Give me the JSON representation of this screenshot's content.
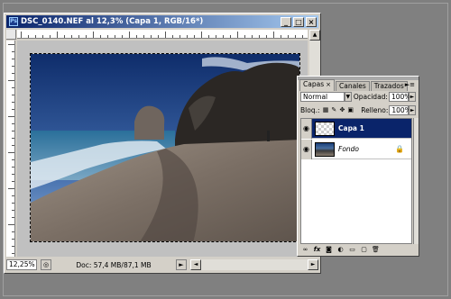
{
  "document": {
    "title": "DSC_0140.NEF al 12,3% (Capa 1, RGB/16*)",
    "app_icon": "Ps",
    "window_buttons": [
      "_",
      "□",
      "×"
    ],
    "zoom": "12,25%",
    "doc_info": "Doc: 57,4 MB/87,1 MB",
    "scroll_left": "◄",
    "scroll_right": "►",
    "scroll_up": "▲",
    "scroll_down": "▼"
  },
  "layers_panel": {
    "tabs": [
      {
        "label": "Capas",
        "active": true,
        "close": "×"
      },
      {
        "label": "Canales",
        "active": false
      },
      {
        "label": "Trazados",
        "active": false
      }
    ],
    "menu_icon": "►≡",
    "blend_mode": "Normal",
    "blend_dropdown": "▼",
    "opacity_label": "Opacidad:",
    "opacity_value": "100%",
    "lock_label": "Bloq.:",
    "fill_label": "Relleno:",
    "fill_value": "100%",
    "arrow": "►",
    "layers": [
      {
        "name": "Capa 1",
        "selected": true,
        "visible": true,
        "thumb": "transparent"
      },
      {
        "name": "Fondo",
        "selected": false,
        "visible": true,
        "thumb": "image",
        "locked": true
      }
    ],
    "bottom_icons": [
      "link-icon",
      "fx-icon",
      "mask-icon",
      "adjustment-icon",
      "folder-icon",
      "new-layer-icon",
      "trash-icon"
    ]
  },
  "colors": {
    "title_bar": "#0a246a",
    "selected_layer": "#0a246a",
    "panel_bg": "#d4d0c8",
    "desktop_bg": "#808080"
  }
}
